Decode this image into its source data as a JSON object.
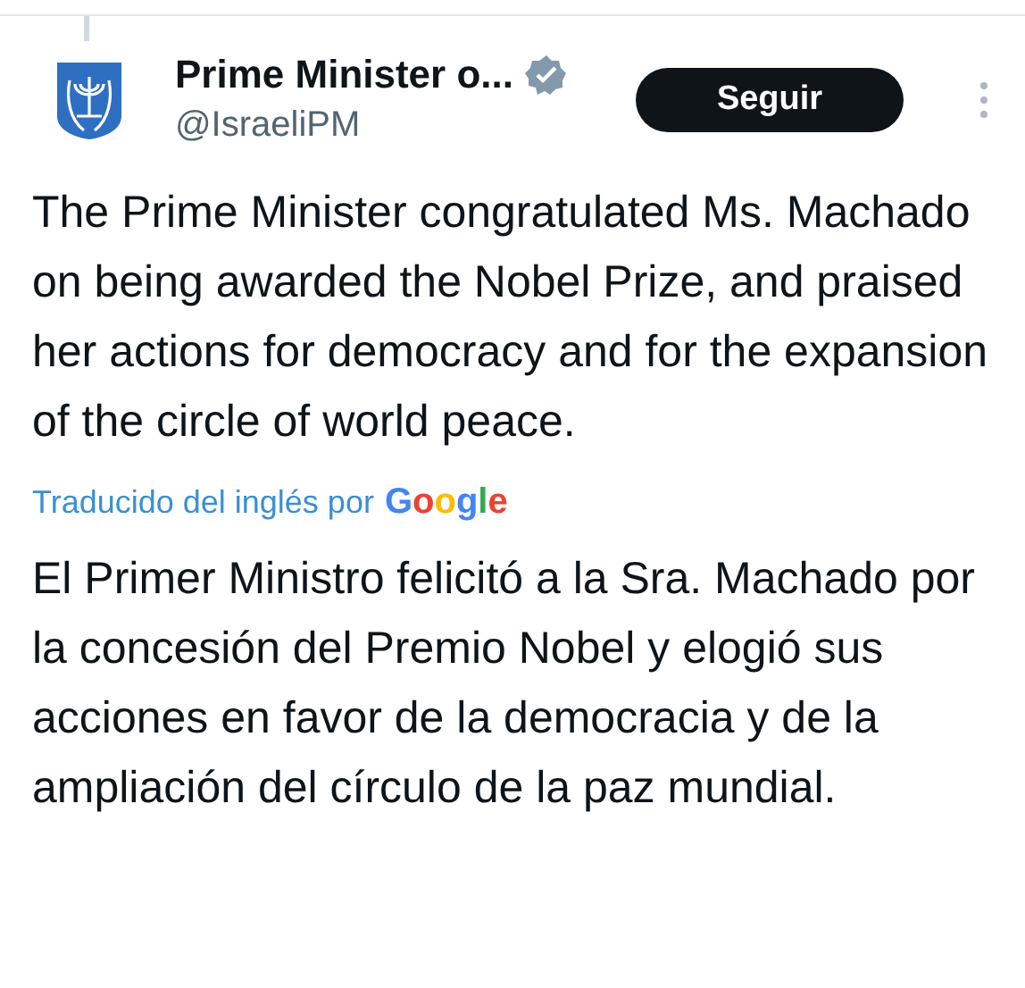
{
  "author": {
    "name": "Prime Minister o...",
    "verified": true,
    "handle": "@IsraeliPM"
  },
  "follow_button": {
    "label": "Seguir"
  },
  "post": {
    "text": "The Prime Minister congratulated Ms. Machado on being awarded the Nobel Prize, and praised her actions for democracy and for the expansion of the circle of world peace."
  },
  "translation": {
    "label": "Traducido del inglés por",
    "provider": "Google",
    "text": "El Primer Ministro felicitó a la Sra. Machado por la concesión del Premio Nobel y elogió sus acciones en favor de la democracia y de la ampliación del círculo de la paz mundial."
  }
}
